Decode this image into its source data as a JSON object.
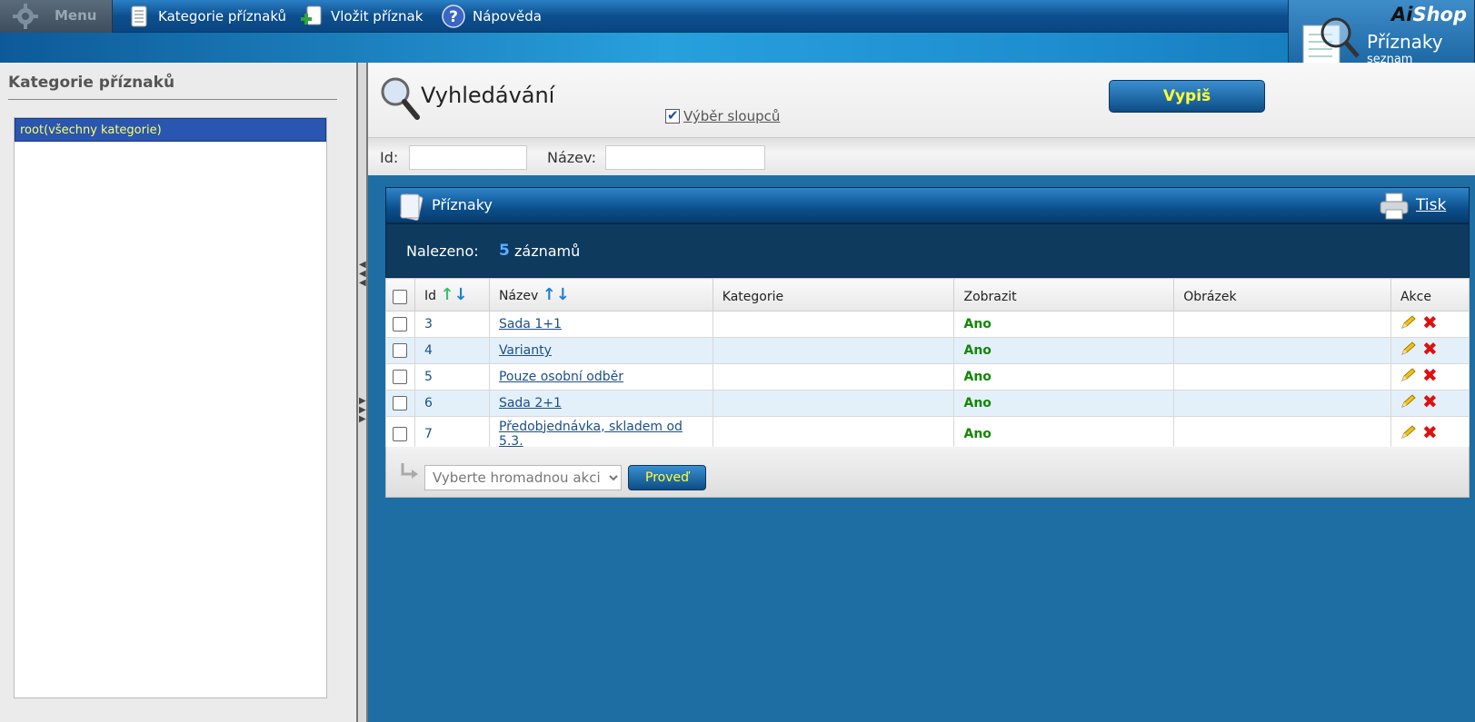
{
  "topnav": {
    "menu_label": "Menu",
    "items": [
      {
        "label": "Kategorie příznaků"
      },
      {
        "label": "Vložit příznak"
      },
      {
        "label": "Nápověda"
      }
    ]
  },
  "brand": {
    "logo_ai": "Ai",
    "logo_shop": "Shop",
    "title": "Příznaky",
    "subtitle": "seznam"
  },
  "sidebar": {
    "heading": "Kategorie příznaků",
    "tree_selected": "root(všechny kategorie)"
  },
  "search": {
    "title": "Vyhledávání",
    "columns_link": "Výběr sloupců",
    "columns_checked": true,
    "submit_label": "Vypiš",
    "filters": {
      "id_label": "Id:",
      "id_value": "",
      "name_label": "Název:",
      "name_value": ""
    }
  },
  "panel": {
    "title": "Příznaky",
    "print_label": "Tisk",
    "found_label": "Nalezeno:",
    "found_count": "5",
    "found_suffix": "záznamů"
  },
  "table": {
    "headers": {
      "id": "Id",
      "name": "Název",
      "category": "Kategorie",
      "show": "Zobrazit",
      "image": "Obrázek",
      "actions": "Akce"
    },
    "rows": [
      {
        "id": "3",
        "name": "Sada 1+1",
        "category": "",
        "show": "Ano",
        "image": ""
      },
      {
        "id": "4",
        "name": "Varianty",
        "category": "",
        "show": "Ano",
        "image": ""
      },
      {
        "id": "5",
        "name": "Pouze osobní odběr",
        "category": "",
        "show": "Ano",
        "image": ""
      },
      {
        "id": "6",
        "name": "Sada 2+1",
        "category": "",
        "show": "Ano",
        "image": ""
      },
      {
        "id": "7",
        "name": "Předobjednávka, skladem od 5.3.",
        "category": "",
        "show": "Ano",
        "image": ""
      }
    ]
  },
  "bulk": {
    "select_placeholder": "Vyberte hromadnou akci",
    "submit_label": "Proveď"
  },
  "colors": {
    "accent_yellow": "#ffff33",
    "nav_blue": "#0d4f8f",
    "selected_tree": "#2a55b0",
    "ano_green": "#118800"
  }
}
